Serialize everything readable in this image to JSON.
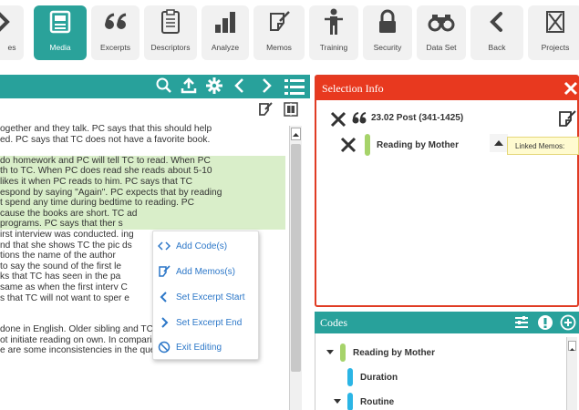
{
  "toolbar": {
    "items": [
      {
        "label": "es",
        "icon": "chevron-right-icon"
      },
      {
        "label": "Media",
        "icon": "media-icon",
        "active": true
      },
      {
        "label": "Excerpts",
        "icon": "quote-icon"
      },
      {
        "label": "Descriptors",
        "icon": "clipboard-icon"
      },
      {
        "label": "Analyze",
        "icon": "bar-chart-icon"
      },
      {
        "label": "Memos",
        "icon": "memo-icon"
      },
      {
        "label": "Training",
        "icon": "training-icon"
      },
      {
        "label": "Security",
        "icon": "lock-icon"
      },
      {
        "label": "Data Set",
        "icon": "binoculars-icon"
      },
      {
        "label": "Back",
        "icon": "chevron-left-icon"
      },
      {
        "label": "Projects",
        "icon": "projects-icon"
      }
    ],
    "active_color": "#2aa29a"
  },
  "document": {
    "header_color": "#28a19b",
    "header_icons": [
      "search-icon",
      "upload-icon",
      "gear-icon",
      "prev-icon",
      "next-icon",
      "list-icon"
    ],
    "lines": [
      {
        "text": "ogether and they talk.  PC says that this should help",
        "hl": false
      },
      {
        "text": "ed.  PC says that TC does not have a favorite book.",
        "hl": false
      },
      {
        "text": "",
        "hl": false
      },
      {
        "text": "do homework and PC will tell TC to read.  When PC",
        "hl": true
      },
      {
        "text": "th to TC.  When PC does read she reads about 5-10",
        "hl": true
      },
      {
        "text": "likes it when PC reads to him.  PC says that TC",
        "hl": true
      },
      {
        "text": "espond by saying \"Again\".  PC expects that by reading",
        "hl": true
      },
      {
        "text": "t spend any time during bedtime to reading.  PC",
        "hl": true
      },
      {
        "text": "cause the books are short.  TC                        ad",
        "hl": true
      },
      {
        "text": "programs.  PC says that ther                           s",
        "hl": true
      },
      {
        "text": "irst interview was conducted.                          ing",
        "hl": false
      },
      {
        "text": "nd that she shows TC the pic                           ds",
        "hl": false
      },
      {
        "text": "tions the name of the author",
        "hl": false
      },
      {
        "text": "to say the sound of the first le",
        "hl": false
      },
      {
        "text": "ks that TC has seen in the pa",
        "hl": false
      },
      {
        "text": "same as when the first interv                          C",
        "hl": false
      },
      {
        "text": "s that TC will not want to sper                        e",
        "hl": false
      },
      {
        "text": "",
        "hl": false
      },
      {
        "text": "",
        "hl": false
      },
      {
        "text": "done in English.  Older sibling and TC somewhat like",
        "hl": false
      },
      {
        "text": "ot initiate reading on own.  In comparison to the first",
        "hl": false
      },
      {
        "text": "e are some inconsistencies in the questions (ie. age)",
        "hl": false
      }
    ],
    "highlight_color": "#d9eec9"
  },
  "context_menu": {
    "items": [
      {
        "label": "Add Code(s)",
        "icon": "code-icon"
      },
      {
        "label": "Add Memos(s)",
        "icon": "memo-icon"
      },
      {
        "label": "Set Excerpt Start",
        "icon": "chevron-left-icon"
      },
      {
        "label": "Set Excerpt End",
        "icon": "chevron-right-icon"
      },
      {
        "label": "Exit Editing",
        "icon": "cancel-icon"
      }
    ],
    "text_color": "#2c77c8"
  },
  "selection_info": {
    "title": "Selection Info",
    "header_color": "#e8391f",
    "excerpt_label": "23.02 Post (341-1425)",
    "code_label": "Reading by Mother",
    "tooltip": "Linked Memos:"
  },
  "codes": {
    "title": "Codes",
    "header_color": "#28a19b",
    "items": [
      {
        "label": "Reading by Mother",
        "color": "#a6d36a",
        "expanded": true
      },
      {
        "label": "Duration",
        "color": "#2bb5e5",
        "expanded": false
      },
      {
        "label": "Routine",
        "color": "#2bb5e5",
        "expanded": true
      }
    ]
  }
}
